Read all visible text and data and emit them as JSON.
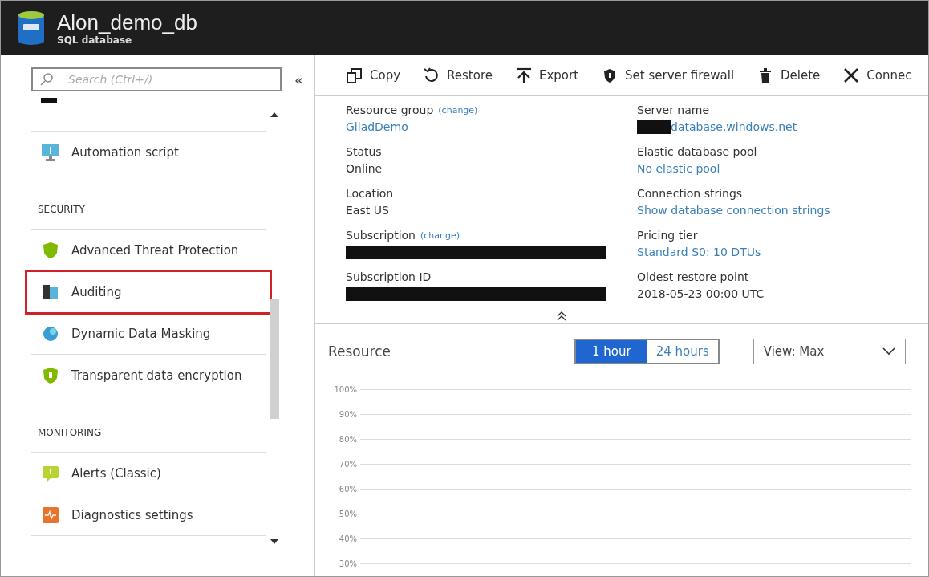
{
  "header": {
    "title": "Alon_demo_db",
    "subtitle": "SQL database"
  },
  "sidebar": {
    "search": {
      "placeholder": "Search (Ctrl+/)"
    },
    "collapse": "«",
    "items": [
      {
        "kind": "item",
        "label": "Automation script",
        "highlighted": false
      },
      {
        "kind": "section",
        "label": "SECURITY"
      },
      {
        "kind": "item",
        "label": "Advanced Threat Protection",
        "highlighted": false
      },
      {
        "kind": "item",
        "label": "Auditing",
        "highlighted": true
      },
      {
        "kind": "item",
        "label": "Dynamic Data Masking",
        "highlighted": false
      },
      {
        "kind": "item",
        "label": "Transparent data encryption",
        "highlighted": false
      },
      {
        "kind": "section",
        "label": "MONITORING"
      },
      {
        "kind": "item",
        "label": "Alerts (Classic)",
        "highlighted": false
      },
      {
        "kind": "item",
        "label": "Diagnostics settings",
        "highlighted": false
      }
    ]
  },
  "toolbar": [
    "Copy",
    "Restore",
    "Export",
    "Set server firewall",
    "Delete",
    "Connec"
  ],
  "essentials": {
    "columns": [
      [
        {
          "label": "Resource group",
          "change": "(change)",
          "value": "GiladDemo",
          "link": true
        },
        {
          "label": "Status",
          "value": "Online"
        },
        {
          "label": "Location",
          "value": "East US"
        },
        {
          "label": "Subscription",
          "change": "(change)",
          "redacted": true
        },
        {
          "label": "Subscription ID",
          "redacted": true
        }
      ],
      [
        {
          "label": "Server name",
          "value": "database.windows.net",
          "link": true,
          "redacted": true
        },
        {
          "label": "Elastic database pool",
          "value": "No elastic pool",
          "link": true
        },
        {
          "label": "Connection strings",
          "value": "Show database connection strings",
          "link": true
        },
        {
          "label": "Pricing tier",
          "value": "Standard S0: 10 DTUs",
          "link": true
        },
        {
          "label": "Oldest restore point",
          "value": "2018-05-23 00:00 UTC"
        }
      ]
    ]
  },
  "resource": {
    "title": "Resource",
    "ranges": [
      {
        "label": "1 hour",
        "selected": true
      },
      {
        "label": "24 hours",
        "selected": false
      }
    ],
    "view": "View: Max",
    "y_labels": [
      "100%",
      "90%",
      "80%",
      "70%",
      "60%",
      "50%",
      "40%",
      "30%"
    ]
  }
}
